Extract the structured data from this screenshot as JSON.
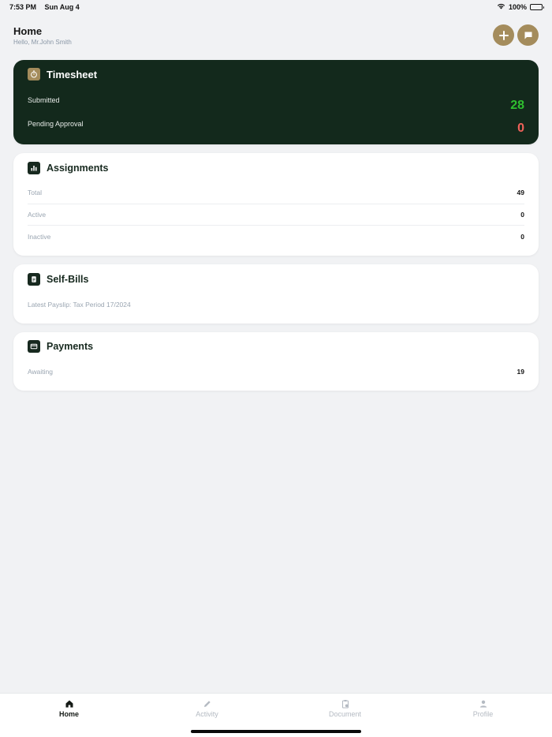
{
  "status": {
    "time": "7:53 PM",
    "date": "Sun Aug 4",
    "battery": "100%"
  },
  "header": {
    "title": "Home",
    "greeting": "Hello, Mr.John Smith"
  },
  "timesheet": {
    "title": "Timesheet",
    "submitted_label": "Submitted",
    "submitted_value": "28",
    "pending_label": "Pending Approval",
    "pending_value": "0"
  },
  "assignments": {
    "title": "Assignments",
    "rows": [
      {
        "label": "Total",
        "value": "49"
      },
      {
        "label": "Active",
        "value": "0"
      },
      {
        "label": "Inactive",
        "value": "0"
      }
    ]
  },
  "selfbills": {
    "title": "Self-Bills",
    "latest": "Latest Payslip: Tax Period 17/2024"
  },
  "payments": {
    "title": "Payments",
    "rows": [
      {
        "label": "Awaiting",
        "value": "19"
      }
    ]
  },
  "tabs": [
    {
      "label": "Home",
      "icon": "home-icon"
    },
    {
      "label": "Activity",
      "icon": "pencil-icon"
    },
    {
      "label": "Document",
      "icon": "clipboard-icon"
    },
    {
      "label": "Profile",
      "icon": "person-icon"
    }
  ],
  "colors": {
    "brand_dark": "#13291c",
    "accent_gold": "#a48c5c",
    "success": "#2fbf2f",
    "danger": "#f0625a"
  }
}
